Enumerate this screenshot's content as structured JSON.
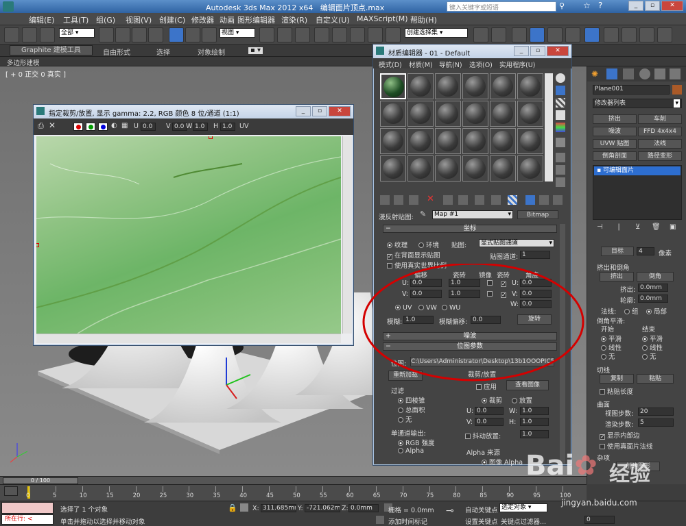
{
  "app": {
    "title": "Autodesk 3ds Max  2012 x64",
    "doc_title": "编辑面片顶点.max",
    "search_placeholder": "键入关键字或短语"
  },
  "menu": [
    "编辑(E)",
    "工具(T)",
    "组(G)",
    "视图(V)",
    "创建(C)",
    "修改器",
    "动画",
    "图形编辑器",
    "渲染(R)",
    "自定义(U)",
    "MAXScript(M)",
    "帮助(H)"
  ],
  "toolbar": {
    "selection_filter": "全部",
    "ref_coord": "视图",
    "named_selection": "创建选择集"
  },
  "ribbon": {
    "tabs": [
      "Graphite 建模工具",
      "自由形式",
      "选择",
      "对象绘制"
    ],
    "sub": "多边形建模"
  },
  "viewport": {
    "label": "[ + 0 正交 0 真实 ]"
  },
  "crop_window": {
    "title": "指定裁剪/放置, 显示 gamma: 2.2, RGB 颜色 8 位/通道 (1:1)",
    "u_label": "U",
    "u_value": "0.0",
    "v_label": "V",
    "v_value": "0.0",
    "w_label": "W",
    "w_value": "1.0",
    "h_label": "H",
    "h_value": "1.0",
    "uv_label": "UV"
  },
  "mat_editor": {
    "title": "材质编辑器 - 01 - Default",
    "menu": [
      "模式(D)",
      "材质(M)",
      "导航(N)",
      "选项(O)",
      "实用程序(U)"
    ],
    "map_label": "漫反射贴图:",
    "map_name": "Map #1",
    "map_type": "Bitmap",
    "coords": {
      "header": "坐标",
      "texture": "纹理",
      "env": "环境",
      "mapping_label": "贴图:",
      "mapping_value": "显式贴图通道",
      "show_back": "在背面显示贴图",
      "channel_label": "贴图通道:",
      "channel_value": "1",
      "real_world": "使用真实世界比例",
      "col_offset": "偏移",
      "col_tiling": "瓷砖",
      "col_mirror": "镜像",
      "col_tile": "瓷砖",
      "col_angle": "角度",
      "u": "U:",
      "v": "V:",
      "w": "W:",
      "u_off": "0.0",
      "v_off": "0.0",
      "u_tile": "1.0",
      "v_tile": "1.0",
      "u_angle": "0.0",
      "v_angle": "0.0",
      "w_angle": "0.0",
      "uv": "UV",
      "vw": "VW",
      "wu": "WU",
      "blur_label": "模糊:",
      "blur_value": "1.0",
      "blur_off_label": "模糊偏移:",
      "blur_off_value": "0.0",
      "rotate": "旋转"
    },
    "noise_header": "噪波",
    "bitmap": {
      "header": "位图参数",
      "path_label": "位图:",
      "path": "C:\\Users\\Administrator\\Desktop\\13b1OOOPIC57.jpg",
      "reload": "重新加载",
      "crop_group": "裁剪/放置",
      "apply": "应用",
      "view_image": "查看图像",
      "crop": "裁剪",
      "place": "放置",
      "cu": "U:",
      "cu_v": "0.0",
      "cw": "W:",
      "cw_v": "1.0",
      "cv": "V:",
      "cv_v": "0.0",
      "ch": "H:",
      "ch_v": "1.0",
      "jitter": "抖动放置:",
      "jitter_v": "1.0",
      "filter_group": "过滤",
      "f1": "四棱锥",
      "f2": "总面积",
      "f3": "无",
      "mono_group": "单通道输出:",
      "m1": "RGB 强度",
      "m2": "Alpha",
      "alpha_group": "Alpha 来源",
      "a1": "图像 Alpha"
    }
  },
  "cmd": {
    "object_name": "Plane001",
    "modifier_list": "修改器列表",
    "buttons": [
      [
        "挤出",
        "车削"
      ],
      [
        "噪波",
        "FFD 4x4x4"
      ],
      [
        "UVW 贴图",
        "法线"
      ],
      [
        "倒角剖面",
        "路径变形"
      ]
    ],
    "stack_item": "可编辑面片",
    "target": "目标",
    "target_val": "4",
    "pixel": "像素",
    "extrude_group": "挤出和倒角",
    "extrude": "挤出",
    "bevel": "倒角",
    "extrude_label": "挤出:",
    "extrude_val": "0.0mm",
    "outline_label": "轮廓:",
    "outline_val": "0.0mm",
    "normal_label": "法线:",
    "group": "组",
    "local": "局部",
    "bevel_smooth": "倒角平滑:",
    "start": "开始",
    "end": "结束",
    "smooth": "平滑",
    "linear": "线性",
    "none": "无",
    "tangent": "切线",
    "copy": "复制",
    "paste": "粘贴",
    "paste_len": "粘贴长度",
    "surface": "曲面",
    "view_steps": "视图步数:",
    "view_steps_val": "20",
    "render_steps": "渲染步数:",
    "render_steps_val": "5",
    "show_interior": "显示内部边",
    "true_normals": "使用真面片法线",
    "misc": "杂项",
    "create_shape": "创建图形"
  },
  "timeline": {
    "frame": "0 / 100",
    "ticks": [
      "0",
      "5",
      "10",
      "15",
      "20",
      "25",
      "30",
      "35",
      "40",
      "45",
      "50",
      "55",
      "60",
      "65",
      "70",
      "75",
      "80",
      "85",
      "90",
      "95",
      "100"
    ]
  },
  "status": {
    "left_box": "所在行:",
    "selected": "选择了 1 个对象",
    "hint": "单击并拖动以选择并移动对象",
    "x_label": "X:",
    "x_val": "311.685mm",
    "y_label": "Y:",
    "y_val": "-721.062m",
    "z_label": "Z:",
    "z_val": "0.0mm",
    "grid": "栅格 = 0.0mm",
    "add_time_tag": "添加时间标记",
    "auto_key": "自动关键点",
    "set_key": "设置关键点",
    "key_mode": "选定对象",
    "key_filters": "关键点过滤器...",
    "frame_val": "0"
  },
  "watermark": {
    "brand": "Bai",
    "brand2": "经验",
    "url": "jingyan.baidu.com"
  },
  "colors": {
    "accent": "#2f63a3",
    "highlight": "#2d6ed0",
    "annotation": "#d40000"
  }
}
